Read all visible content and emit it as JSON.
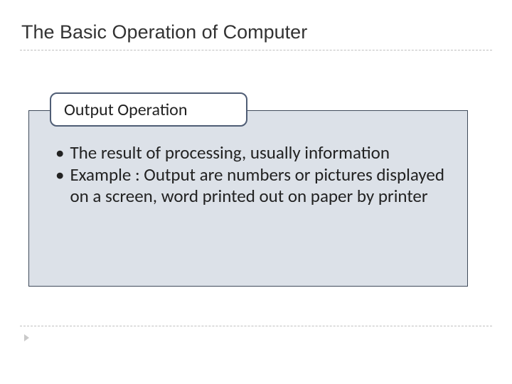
{
  "title": "The Basic Operation of Computer",
  "box": {
    "heading": "Output Operation",
    "bullets": [
      "The result of processing, usually information",
      "Example : Output are numbers or pictures displayed on a screen,  word printed out on paper by printer"
    ]
  }
}
